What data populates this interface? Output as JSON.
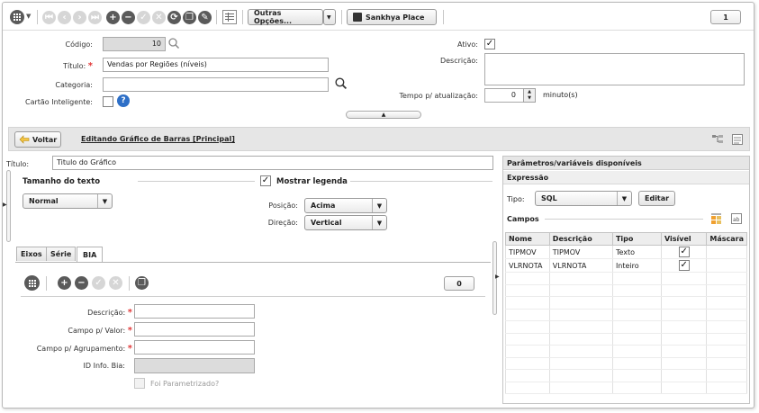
{
  "toolbar": {
    "more_options_label": "Outras Opções...",
    "sankhya_place_label": "Sankhya Place",
    "counter": "1"
  },
  "form": {
    "codigo_label": "Código:",
    "codigo_value": "10",
    "titulo_label": "Título:",
    "titulo_value": "Vendas por Regiões (níveis)",
    "categoria_label": "Categoria:",
    "categoria_value": "",
    "cartao_label": "Cartão Inteligente:",
    "ativo_label": "Ativo:",
    "descricao_label": "Descrição:",
    "descricao_value": "",
    "tempo_label": "Tempo p/ atualização:",
    "tempo_value": "0",
    "tempo_unit": "minuto(s)"
  },
  "edit_bar": {
    "back_label": "Voltar",
    "title": "Editando Gráfico de Barras [Principal]"
  },
  "chart_config": {
    "titulo_label": "Título:",
    "titulo_value": "Titulo do Gráfico",
    "tamanho_label": "Tamanho do texto",
    "tamanho_value": "Normal",
    "legenda_label": "Mostrar legenda",
    "posicao_label": "Posição:",
    "posicao_value": "Acima",
    "direcao_label": "Direção:",
    "direcao_value": "Vertical"
  },
  "tabs": [
    {
      "label": "Eixos"
    },
    {
      "label": "Série"
    },
    {
      "label": "BIA"
    }
  ],
  "bia": {
    "counter": "0",
    "descricao_label": "Descrição:",
    "campo_valor_label": "Campo p/ Valor:",
    "campo_agrup_label": "Campo p/ Agrupamento:",
    "id_info_label": "ID Info. Bia:",
    "foi_param_label": "Foi Parametrizado?"
  },
  "params": {
    "header": "Parâmetros/variáveis disponíveis",
    "expressao_label": "Expressão",
    "tipo_label": "Tipo:",
    "tipo_value": "SQL",
    "editar_label": "Editar",
    "campos_label": "Campos",
    "columns": [
      "Nome",
      "Descrição",
      "Tipo",
      "Visível",
      "Máscara"
    ],
    "rows": [
      {
        "nome": "TIPMOV",
        "descricao": "TIPMOV",
        "tipo": "Texto",
        "visivel": true,
        "mascara": ""
      },
      {
        "nome": "VLRNOTA",
        "descricao": "VLRNOTA",
        "tipo": "Inteiro",
        "visivel": true,
        "mascara": ""
      }
    ]
  },
  "colors": {
    "dark_button": "#5a5a5a",
    "light_button": "#d6d6d6",
    "help_blue": "#2d6fc7",
    "required_red": "#e23a3a",
    "header_gray": "#e6e6e6"
  }
}
